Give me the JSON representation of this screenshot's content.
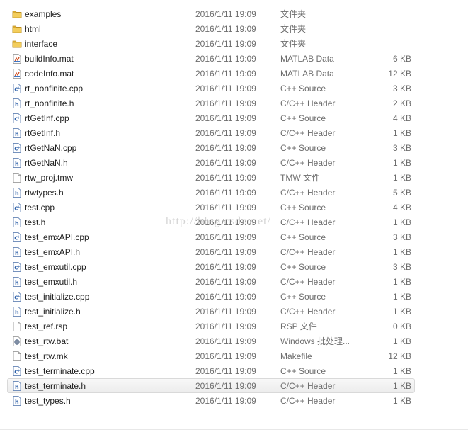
{
  "files": [
    {
      "name": "examples",
      "date": "2016/1/11 19:09",
      "type": "文件夹",
      "size": "",
      "icon": "folder-icon"
    },
    {
      "name": "html",
      "date": "2016/1/11 19:09",
      "type": "文件夹",
      "size": "",
      "icon": "folder-icon"
    },
    {
      "name": "interface",
      "date": "2016/1/11 19:09",
      "type": "文件夹",
      "size": "",
      "icon": "folder-icon"
    },
    {
      "name": "buildInfo.mat",
      "date": "2016/1/11 19:09",
      "type": "MATLAB Data",
      "size": "6 KB",
      "icon": "mat-file-icon"
    },
    {
      "name": "codeInfo.mat",
      "date": "2016/1/11 19:09",
      "type": "MATLAB Data",
      "size": "12 KB",
      "icon": "mat-file-icon"
    },
    {
      "name": "rt_nonfinite.cpp",
      "date": "2016/1/11 19:09",
      "type": "C++ Source",
      "size": "3 KB",
      "icon": "cpp-file-icon"
    },
    {
      "name": "rt_nonfinite.h",
      "date": "2016/1/11 19:09",
      "type": "C/C++ Header",
      "size": "2 KB",
      "icon": "h-file-icon"
    },
    {
      "name": "rtGetInf.cpp",
      "date": "2016/1/11 19:09",
      "type": "C++ Source",
      "size": "4 KB",
      "icon": "cpp-file-icon"
    },
    {
      "name": "rtGetInf.h",
      "date": "2016/1/11 19:09",
      "type": "C/C++ Header",
      "size": "1 KB",
      "icon": "h-file-icon"
    },
    {
      "name": "rtGetNaN.cpp",
      "date": "2016/1/11 19:09",
      "type": "C++ Source",
      "size": "3 KB",
      "icon": "cpp-file-icon"
    },
    {
      "name": "rtGetNaN.h",
      "date": "2016/1/11 19:09",
      "type": "C/C++ Header",
      "size": "1 KB",
      "icon": "h-file-icon"
    },
    {
      "name": "rtw_proj.tmw",
      "date": "2016/1/11 19:09",
      "type": "TMW 文件",
      "size": "1 KB",
      "icon": "blank-file-icon"
    },
    {
      "name": "rtwtypes.h",
      "date": "2016/1/11 19:09",
      "type": "C/C++ Header",
      "size": "5 KB",
      "icon": "h-file-icon"
    },
    {
      "name": "test.cpp",
      "date": "2016/1/11 19:09",
      "type": "C++ Source",
      "size": "4 KB",
      "icon": "cpp-file-icon"
    },
    {
      "name": "test.h",
      "date": "2016/1/11 19:09",
      "type": "C/C++ Header",
      "size": "1 KB",
      "icon": "h-file-icon"
    },
    {
      "name": "test_emxAPI.cpp",
      "date": "2016/1/11 19:09",
      "type": "C++ Source",
      "size": "3 KB",
      "icon": "cpp-file-icon"
    },
    {
      "name": "test_emxAPI.h",
      "date": "2016/1/11 19:09",
      "type": "C/C++ Header",
      "size": "1 KB",
      "icon": "h-file-icon"
    },
    {
      "name": "test_emxutil.cpp",
      "date": "2016/1/11 19:09",
      "type": "C++ Source",
      "size": "3 KB",
      "icon": "cpp-file-icon"
    },
    {
      "name": "test_emxutil.h",
      "date": "2016/1/11 19:09",
      "type": "C/C++ Header",
      "size": "1 KB",
      "icon": "h-file-icon"
    },
    {
      "name": "test_initialize.cpp",
      "date": "2016/1/11 19:09",
      "type": "C++ Source",
      "size": "1 KB",
      "icon": "cpp-file-icon"
    },
    {
      "name": "test_initialize.h",
      "date": "2016/1/11 19:09",
      "type": "C/C++ Header",
      "size": "1 KB",
      "icon": "h-file-icon"
    },
    {
      "name": "test_ref.rsp",
      "date": "2016/1/11 19:09",
      "type": "RSP 文件",
      "size": "0 KB",
      "icon": "blank-file-icon"
    },
    {
      "name": "test_rtw.bat",
      "date": "2016/1/11 19:09",
      "type": "Windows 批处理...",
      "size": "1 KB",
      "icon": "bat-file-icon"
    },
    {
      "name": "test_rtw.mk",
      "date": "2016/1/11 19:09",
      "type": "Makefile",
      "size": "12 KB",
      "icon": "blank-file-icon"
    },
    {
      "name": "test_terminate.cpp",
      "date": "2016/1/11 19:09",
      "type": "C++ Source",
      "size": "1 KB",
      "icon": "cpp-file-icon"
    },
    {
      "name": "test_terminate.h",
      "date": "2016/1/11 19:09",
      "type": "C/C++ Header",
      "size": "1 KB",
      "icon": "h-file-icon",
      "selected": true
    },
    {
      "name": "test_types.h",
      "date": "2016/1/11 19:09",
      "type": "C/C++ Header",
      "size": "1 KB",
      "icon": "h-file-icon"
    }
  ],
  "watermark": "http://blog.csdn.net/",
  "colors": {
    "folder": "#e8b83a",
    "file_icon_accent": "#2a5ea8",
    "secondary_text": "#6d6d6d",
    "selection_border": "#d9d9d9"
  }
}
